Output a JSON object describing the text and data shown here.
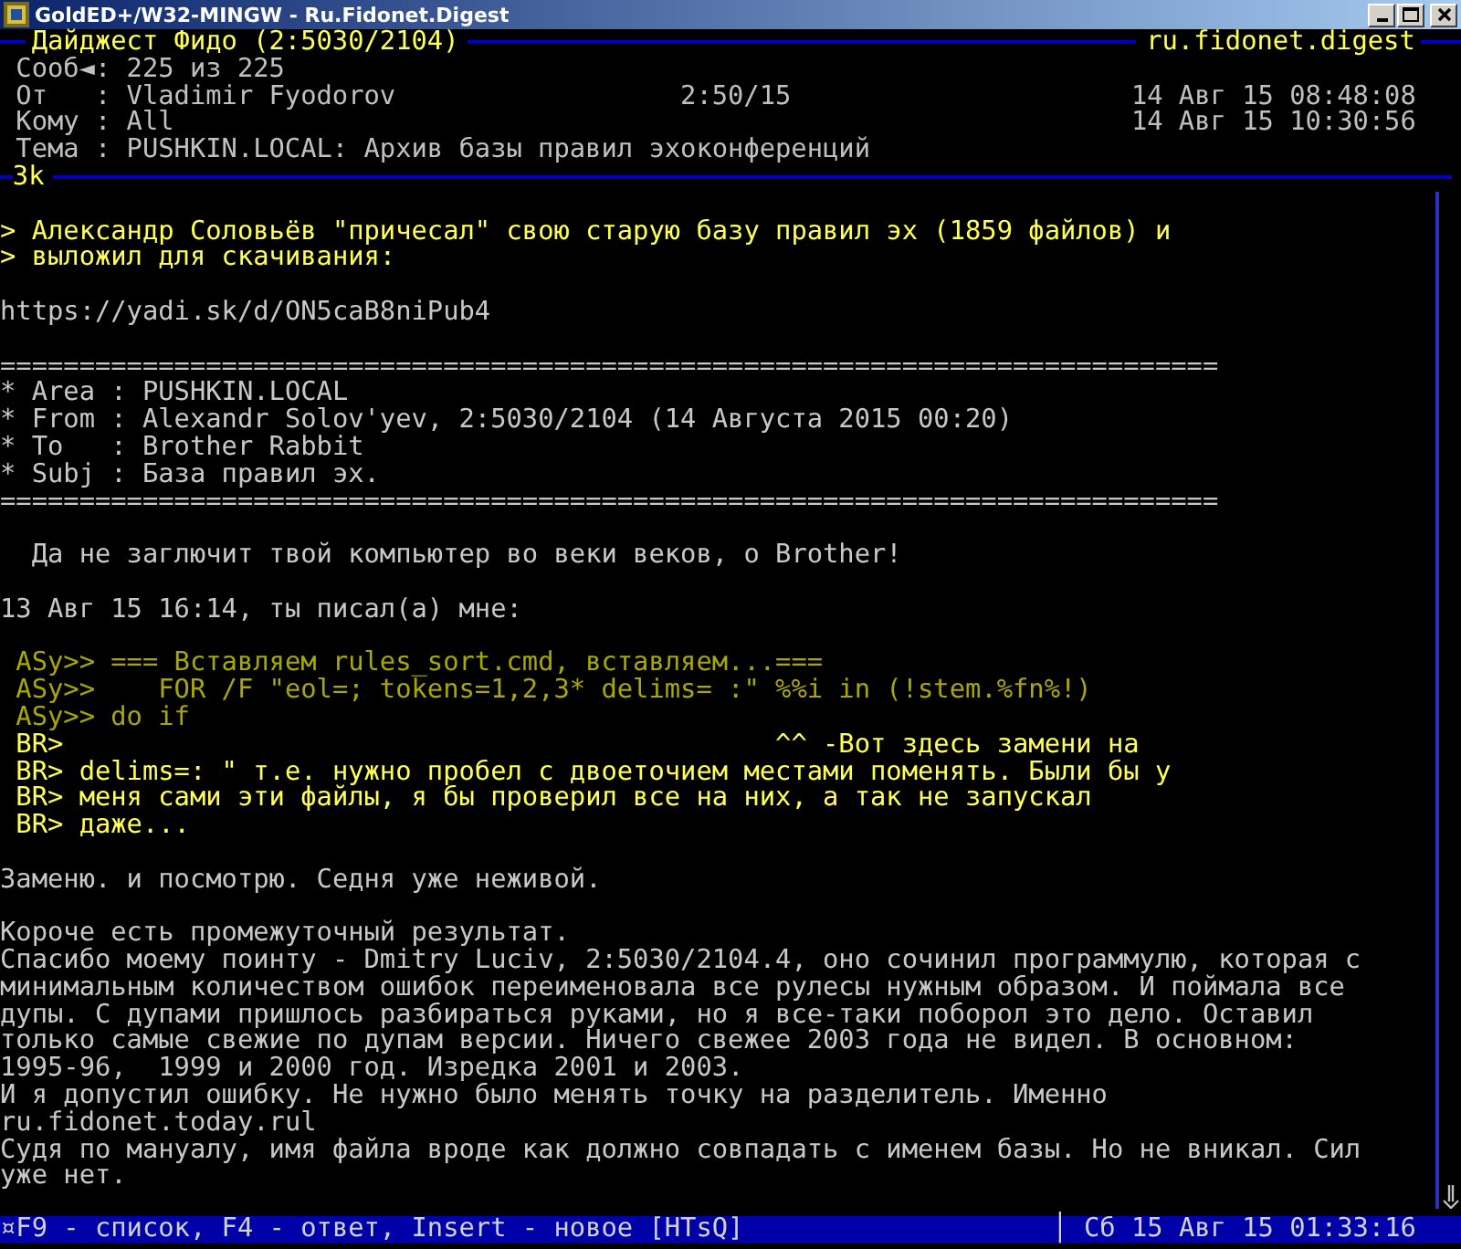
{
  "window": {
    "title": "GoldED+/W32-MINGW - Ru.Fidonet.Digest"
  },
  "header": {
    "area_title": "Дайджест Фидо (2:5030/2104)",
    "echo": "ru.fidonet.digest",
    "size": "3k",
    "fields": [
      {
        "label": "Сооб◄:",
        "value": "225 из 225"
      },
      {
        "label": "От   :",
        "value": "Vladimir Fyodorov",
        "address": "2:50/15",
        "date": "14 Авг 15 08:48:08"
      },
      {
        "label": "Кому :",
        "value": "All",
        "date": "14 Авг 15 10:30:56"
      },
      {
        "label": "Тема :",
        "value": "PUSHKIN.LOCAL: Архив базы правил эхоконференций"
      }
    ]
  },
  "lines": [
    {
      "kind": "blank"
    },
    {
      "kind": "quote",
      "text": "> Александр Соловьёв \"причесал\" свою старую базу правил эх (1859 файлов) и"
    },
    {
      "kind": "quote",
      "text": "> выложил для скачивания:"
    },
    {
      "kind": "blank"
    },
    {
      "kind": "text",
      "text": "https://yadi.sk/d/ON5caB8niPub4"
    },
    {
      "kind": "blank"
    },
    {
      "kind": "rule",
      "text": "============================================================================="
    },
    {
      "kind": "text",
      "text": "* Area : PUSHKIN.LOCAL"
    },
    {
      "kind": "text",
      "text": "* From : Alexandr Solov'yev, 2:5030/2104 (14 Августа 2015 00:20)"
    },
    {
      "kind": "text",
      "text": "* To   : Brother Rabbit"
    },
    {
      "kind": "text",
      "text": "* Subj : База правил эх."
    },
    {
      "kind": "rule",
      "text": "============================================================================="
    },
    {
      "kind": "blank"
    },
    {
      "kind": "text",
      "text": "  Да не заглючит твой компьютер во веки веков, о Brother!"
    },
    {
      "kind": "blank"
    },
    {
      "kind": "text",
      "text": "13 Авг 15 16:14, ты писал(а) мне:"
    },
    {
      "kind": "blank"
    },
    {
      "kind": "old-quote",
      "text": " ASy>> === Вставляем rules_sort.cmd, вставляем...==="
    },
    {
      "kind": "old-quote",
      "text": " ASy>>    FOR /F \"eol=; tokens=1,2,3* delims= :\" %%i in (!stem.%fn%!)"
    },
    {
      "kind": "old-quote",
      "text": " ASy>> do if"
    },
    {
      "kind": "quote",
      "text": " BR>                                             ^^ -Вот здесь замени на"
    },
    {
      "kind": "quote",
      "text": " BR> delims=: \" т.е. нужно пробел с двоеточием местами поменять. Были бы у"
    },
    {
      "kind": "quote",
      "text": " BR> меня сами эти файлы, я бы проверил все на них, а так не запускал"
    },
    {
      "kind": "quote",
      "text": " BR> даже..."
    },
    {
      "kind": "blank"
    },
    {
      "kind": "text",
      "text": "Заменю. и посмотрю. Седня уже неживой."
    },
    {
      "kind": "blank"
    },
    {
      "kind": "text",
      "text": "Короче есть промежуточный результат."
    },
    {
      "kind": "text",
      "text": "Спасибо моему поинту - Dmitry Luciv, 2:5030/2104.4, оно сочинил программулю, которая с"
    },
    {
      "kind": "text",
      "text": "минимальным количеством ошибок переименовала все рулесы нужным образом. И поймала все"
    },
    {
      "kind": "text",
      "text": "дупы. С дупами пришлось разбираться руками, но я все-таки поборол это дело. Оставил"
    },
    {
      "kind": "text",
      "text": "только самые свежие по дупам версии. Ничего свежее 2003 года не видел. В основном:"
    },
    {
      "kind": "text",
      "text": "1995-96,  1999 и 2000 год. Изредка 2001 и 2003."
    },
    {
      "kind": "text",
      "text": "И я допустил ошибку. Не нужно было менять точку на разделитель. Именно"
    },
    {
      "kind": "text",
      "text": "ru.fidonet.today.rul"
    },
    {
      "kind": "text",
      "text": "Судя по мануалу, имя файла вроде как должно совпадать с именем базы. Но не вникал. Сил"
    },
    {
      "kind": "text",
      "text": "уже нет."
    }
  ],
  "status_bar": {
    "hint": "¤F9 - список, F4 - ответ, Insert - новое [HTsQ]",
    "separator": "│",
    "clock": "Сб 15 Авг 15 01:33:16"
  }
}
